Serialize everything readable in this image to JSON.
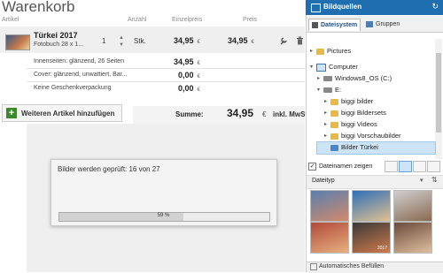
{
  "cart": {
    "title": "Warenkorb",
    "headers": {
      "article": "Artikel",
      "quantity": "Anzahl",
      "unit_price": "Einzelpreis",
      "price": "Preis"
    },
    "product": {
      "name": "Türkei 2017",
      "subtitle": "Fotobuch 28 x 1...",
      "quantity": "1",
      "unit": "Stk.",
      "unit_price": "34,95",
      "price": "34,95",
      "currency": "€"
    },
    "options": [
      {
        "label": "Innenseiten: glänzend, 26 Seiten",
        "value": "34,95"
      },
      {
        "label": "Cover: glänzend, unwattiert, Bar...",
        "value": "0,00"
      },
      {
        "label": "Keine Geschenkverpackung",
        "value": "0,00"
      }
    ],
    "add_button": "Weiteren Artikel hinzufügen",
    "sum_label": "Summe:",
    "sum_value": "34,95",
    "sum_currency": "€",
    "tax_label": "inkl. MwSt."
  },
  "dialog": {
    "message": "Bilder werden geprüft: 16 von 27",
    "progress_percent": 59,
    "progress_label": "59 %"
  },
  "panel": {
    "title": "Bildquellen",
    "tabs": [
      "Dateisystem",
      "Gruppen"
    ],
    "tree": [
      {
        "label": "Pictures",
        "type": "folder",
        "arrow": "▸"
      },
      {
        "label": "Computer",
        "type": "pc",
        "arrow": "▾"
      },
      {
        "label": "Windows8_OS (C:)",
        "type": "drive",
        "arrow": "▸"
      },
      {
        "label": "E:",
        "type": "drive",
        "arrow": "▾"
      },
      {
        "label": "biggi bilder",
        "type": "folder",
        "arrow": "▸"
      },
      {
        "label": "biggi Bildersets",
        "type": "folder",
        "arrow": "▸"
      },
      {
        "label": "biggi Videos",
        "type": "folder",
        "arrow": "▸"
      },
      {
        "label": "biggi Vorschaubilder",
        "type": "folder",
        "arrow": "▸"
      },
      {
        "label": "Bilder Türkei",
        "type": "folder",
        "arrow": ""
      }
    ],
    "show_filenames": "Dateinamen zeigen",
    "sort_by": "Dateityp",
    "footer": "Automatisches Befüllen",
    "thumb_caption": "2017",
    "accent": "#1f6fb0"
  }
}
